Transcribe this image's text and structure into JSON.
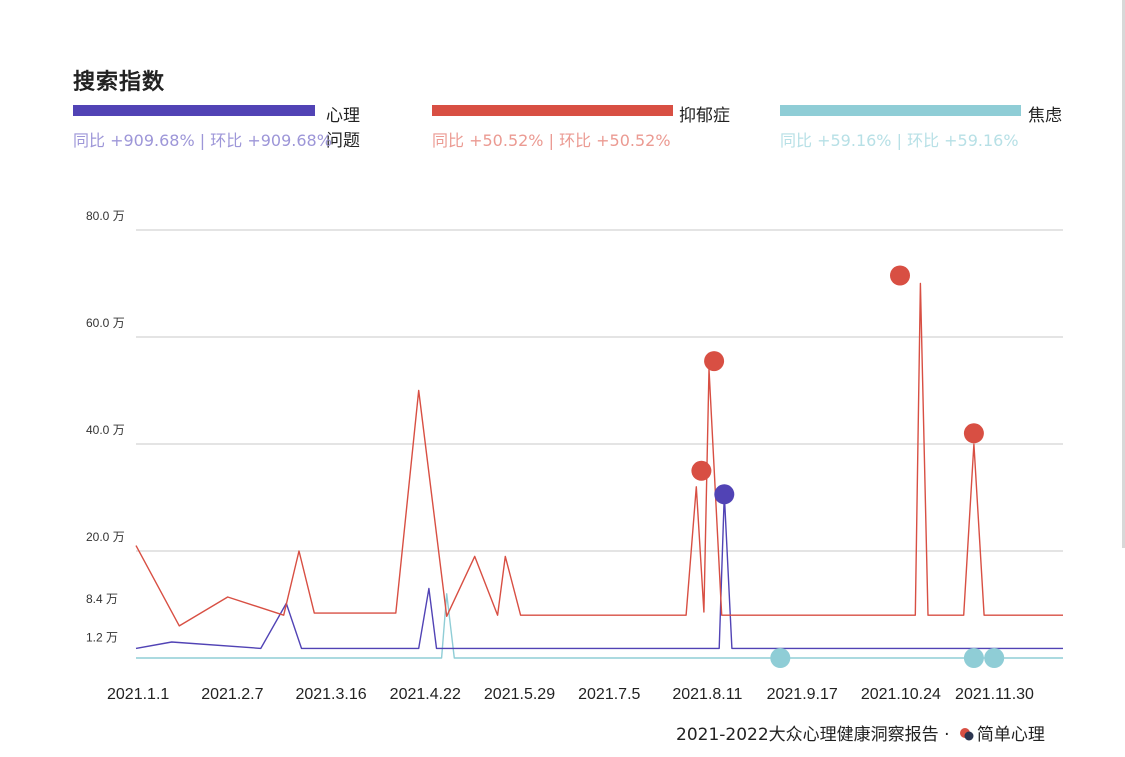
{
  "chart_data": {
    "type": "line",
    "title": "搜索指数",
    "x_tick_labels": [
      "2021.1.1",
      "2021.2.7",
      "2021.3.16",
      "2021.4.22",
      "2021.5.29",
      "2021.7.5",
      "2021.8.11",
      "2021.9.17",
      "2021.10.24",
      "2021.11.30"
    ],
    "y_tick_labels": [
      "80.0 万",
      "60.0 万",
      "40.0 万",
      "20.0 万",
      "8.4 万",
      "1.2 万"
    ],
    "y_ticks": [
      80,
      60,
      40,
      20,
      8.4,
      1.2
    ],
    "ylim": [
      0,
      80
    ],
    "grid": true,
    "series": [
      {
        "name": "心理问题",
        "color": "#5143b5",
        "stats": "同比 +909.68%  | 环比 +909.68%",
        "stats_color": "#9d96d8",
        "points": [
          [
            "2021-01-01",
            1.8
          ],
          [
            "2021-01-15",
            3.0
          ],
          [
            "2021-02-19",
            1.8
          ],
          [
            "2021-03-01",
            10.2
          ],
          [
            "2021-03-07",
            1.8
          ],
          [
            "2021-04-13",
            1.8
          ],
          [
            "2021-04-22",
            1.8
          ],
          [
            "2021-04-26",
            13.0
          ],
          [
            "2021-04-29",
            1.8
          ],
          [
            "2021-06-01",
            1.8
          ],
          [
            "2021-07-05",
            1.8
          ],
          [
            "2021-08-18",
            1.8
          ],
          [
            "2021-08-20",
            30.6
          ],
          [
            "2021-08-23",
            1.8
          ],
          [
            "2021-09-17",
            1.8
          ],
          [
            "2021-10-24",
            1.8
          ],
          [
            "2021-11-30",
            1.8
          ],
          [
            "2021-12-31",
            1.8
          ]
        ],
        "highlight_points": [
          [
            "2021-08-20",
            30.6
          ]
        ]
      },
      {
        "name": "抑郁症",
        "color": "#d84f43",
        "stats": "同比 +50.52%  | 环比 +50.52%",
        "stats_color": "#eb9a92",
        "points": [
          [
            "2021-01-01",
            21.0
          ],
          [
            "2021-01-18",
            6.0
          ],
          [
            "2021-02-06",
            11.4
          ],
          [
            "2021-02-28",
            8.0
          ],
          [
            "2021-03-06",
            20.0
          ],
          [
            "2021-03-12",
            8.4
          ],
          [
            "2021-04-13",
            8.4
          ],
          [
            "2021-04-22",
            50.0
          ],
          [
            "2021-05-03",
            7.8
          ],
          [
            "2021-05-14",
            19.0
          ],
          [
            "2021-05-23",
            8.0
          ],
          [
            "2021-05-26",
            19.0
          ],
          [
            "2021-06-01",
            8.0
          ],
          [
            "2021-07-05",
            8.0
          ],
          [
            "2021-08-05",
            8.0
          ],
          [
            "2021-08-09",
            32.0
          ],
          [
            "2021-08-12",
            8.6
          ],
          [
            "2021-08-14",
            54.0
          ],
          [
            "2021-08-19",
            8.0
          ],
          [
            "2021-09-17",
            8.0
          ],
          [
            "2021-10-24",
            8.0
          ],
          [
            "2021-11-03",
            8.0
          ],
          [
            "2021-11-05",
            70.0
          ],
          [
            "2021-11-08",
            8.0
          ],
          [
            "2021-11-22",
            8.0
          ],
          [
            "2021-11-26",
            40.0
          ],
          [
            "2021-11-30",
            8.0
          ],
          [
            "2021-12-31",
            8.0
          ]
        ],
        "highlight_points": [
          [
            "2021-08-11",
            35.0
          ],
          [
            "2021-08-16",
            55.5
          ],
          [
            "2021-10-28",
            71.5
          ],
          [
            "2021-11-26",
            42.0
          ]
        ]
      },
      {
        "name": "焦虑",
        "color": "#8fcdd6",
        "stats": "同比 +59.16%  | 环比 +59.16%",
        "stats_color": "#b7e0e6",
        "points": [
          [
            "2021-01-01",
            0
          ],
          [
            "2021-04-22",
            0
          ],
          [
            "2021-05-01",
            0
          ],
          [
            "2021-05-03",
            12.0
          ],
          [
            "2021-05-06",
            0
          ],
          [
            "2021-07-05",
            0
          ],
          [
            "2021-09-17",
            0
          ],
          [
            "2021-10-24",
            0
          ],
          [
            "2021-11-30",
            0
          ],
          [
            "2021-12-31",
            0
          ]
        ],
        "highlight_points": [
          [
            "2021-09-11",
            0
          ],
          [
            "2021-11-26",
            0
          ],
          [
            "2021-12-04",
            0
          ]
        ]
      }
    ]
  },
  "footer": {
    "text": "2021-2022大众心理健康洞察报告 · ",
    "brand": "简单心理"
  }
}
